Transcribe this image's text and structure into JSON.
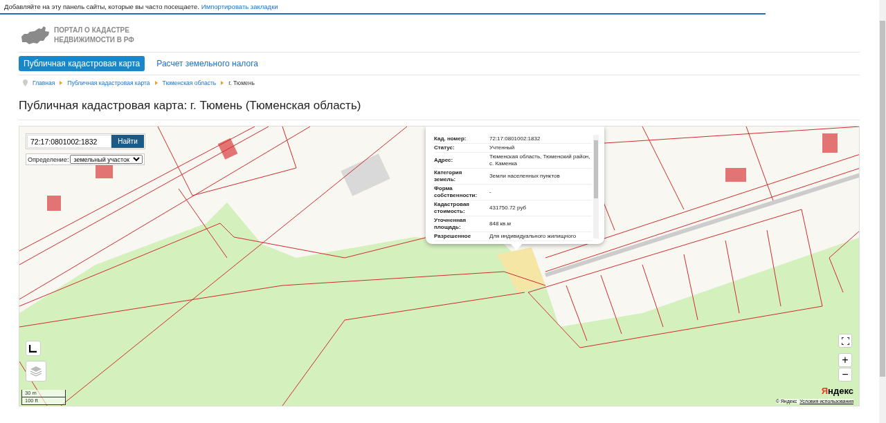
{
  "bookmarks_bar": {
    "text": "Добавляйте на эту панель сайты, которые вы часто посещаете.",
    "link": "Импортировать закладки"
  },
  "logo": {
    "lines": [
      "ПОРТАЛ О КАДАСТРЕ",
      "НЕДВИЖИМОСТИ В РФ"
    ]
  },
  "tabs": [
    {
      "label": "Публичная кадастровая карта",
      "selected": true
    },
    {
      "label": "Расчет земельного налога",
      "selected": false
    }
  ],
  "breadcrumbs": [
    {
      "label": "Главная",
      "kind": "link"
    },
    {
      "label": "Публичная кадастровая карта",
      "kind": "link"
    },
    {
      "label": "Тюменская область",
      "kind": "link"
    },
    {
      "label": "г. Тюмень",
      "kind": "current"
    }
  ],
  "page_title": "Публичная кадастровая карта: г. Тюмень (Тюменская область)",
  "map": {
    "search": {
      "value": "72:17:0801002:1832",
      "button": "Найти"
    },
    "definition": {
      "label": "Определение:",
      "value": "земельный участок"
    },
    "popup": {
      "rows": [
        {
          "label": "Кад. номер:",
          "value": "72:17:0801002:1832"
        },
        {
          "label": "Статус:",
          "value": "Учтенный"
        },
        {
          "label": "Адрес:",
          "value": "Тюменская область, Тюменский район, с. Каменка"
        },
        {
          "label": "Категория земель:",
          "value": "Земли населенных пунктов"
        },
        {
          "label": "Форма собственности:",
          "value": "-"
        },
        {
          "label": "Кадастровая стоимость:",
          "value": "431750.72 руб"
        },
        {
          "label": "Уточненная площадь:",
          "value": "848 кв.м"
        },
        {
          "label": "Разрешенное",
          "value": "Для индивидуального жилищного"
        }
      ]
    },
    "zoom": [
      "+",
      "−"
    ],
    "scale": [
      "30 m",
      "100 ft"
    ],
    "brand": "Яндекс",
    "copyright": "© Яндекс",
    "terms": "Условия использования"
  }
}
